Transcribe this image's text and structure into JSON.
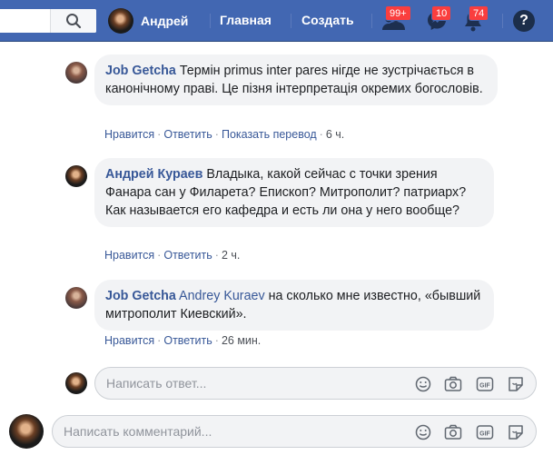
{
  "colors": {
    "brand": "#4267b2",
    "link": "#385898",
    "badge": "#fa3e3e",
    "bubble": "#f2f3f5"
  },
  "topbar": {
    "user_name": "Андрей",
    "home_label": "Главная",
    "create_label": "Создать",
    "friend_requests_badge": "99+",
    "messages_badge": "10",
    "notifications_badge": "74",
    "help_label": "?"
  },
  "comments": [
    {
      "author": "Job Getcha",
      "mention": "",
      "text": "Термін primus inter pares нігде не зустрічається в канонічному праві. Це пізня інтерпретація окремих богословів.",
      "like": "Нравится",
      "reply": "Ответить",
      "translate": "Показать перевод",
      "time": "6 ч."
    },
    {
      "author": "Андрей Кураев",
      "mention": "",
      "text": "Владыка, какой сейчас с точки зрения Фанара сан у Филарета? Епископ? Митрополит? патриарх? Как называется его кафедра и есть ли она у него вообще?",
      "like": "Нравится",
      "reply": "Ответить",
      "time": "2 ч."
    },
    {
      "author": "Job Getcha",
      "mention": "Andrey Kuraev",
      "text": "на сколько мне известно, «бывший митрополит Киевский».",
      "like": "Нравится",
      "reply": "Ответить",
      "time": "26 мин."
    }
  ],
  "reply_box": {
    "placeholder": "Написать ответ..."
  },
  "comment_box": {
    "placeholder": "Написать комментарий..."
  },
  "composer_icons": [
    "emoji-icon",
    "camera-icon",
    "gif-icon",
    "sticker-icon"
  ],
  "gif_label": "GIF"
}
